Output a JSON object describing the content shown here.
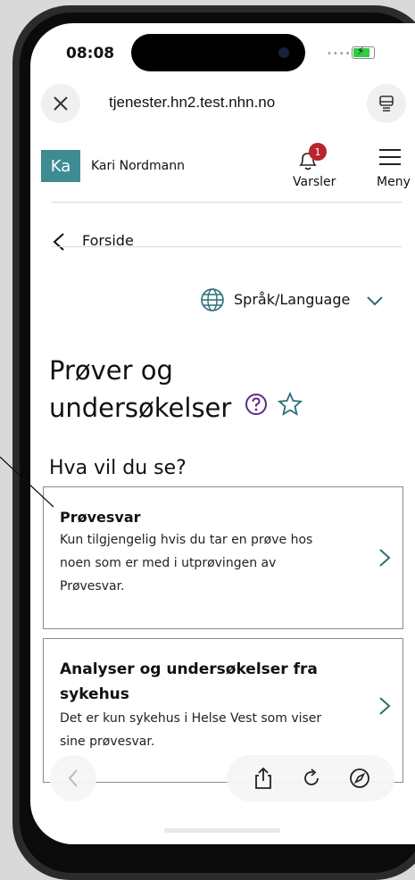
{
  "status_bar": {
    "time": "08:08"
  },
  "browser": {
    "url": "tjenester.hn2.test.nhn.no"
  },
  "header": {
    "avatar_initials": "Ka",
    "user_name": "Kari Nordmann",
    "notifications_count": "1",
    "notifications_label": "Varsler",
    "menu_label": "Meny"
  },
  "breadcrumb": {
    "label": "Forside"
  },
  "language": {
    "label": "Språk/Language"
  },
  "page": {
    "title_line1": "Prøver og",
    "title_line2": "undersøkelser",
    "subheading": "Hva vil du se?"
  },
  "cards": [
    {
      "title": "Prøvesvar",
      "description_lines": [
        "Kun tilgjengelig hvis du tar en prøve hos",
        "noen som er med i utprøvingen av",
        "Prøvesvar."
      ]
    },
    {
      "title_lines": [
        "Analyser og undersøkelser fra",
        "sykehus"
      ],
      "description_lines": [
        "Det er kun sykehus i Helse Vest som viser",
        "sine prøvesvar."
      ]
    }
  ],
  "colors": {
    "brand_teal": "#3f8b93",
    "badge_red": "#b8252c",
    "accent_teal": "#2b6f75"
  }
}
